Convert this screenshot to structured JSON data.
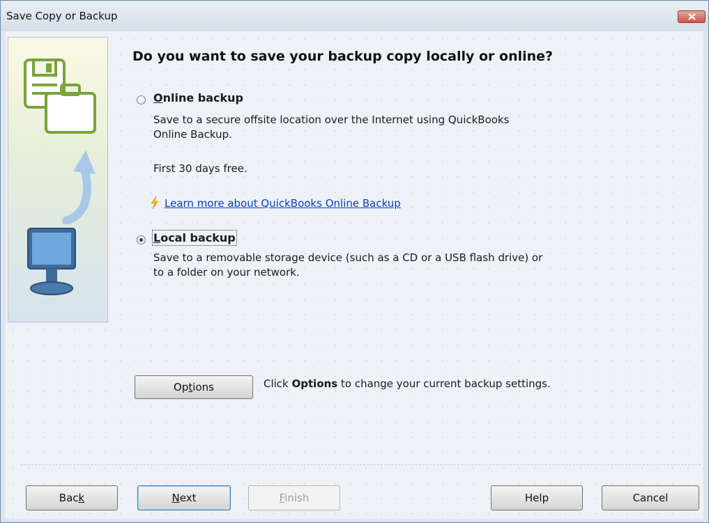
{
  "window": {
    "title": "Save Copy or Backup"
  },
  "heading": "Do you want to save your backup copy locally or online?",
  "online": {
    "label_u": "O",
    "label_rest": "nline backup",
    "desc_line1": "Save to a secure offsite location over the Internet using QuickBooks",
    "desc_line2": "Online Backup.",
    "free": "First 30 days free.",
    "link": "Learn more about QuickBooks Online Backup",
    "checked": false
  },
  "local": {
    "label_u": "L",
    "label_rest": "ocal backup",
    "desc_line1": "Save to a removable storage device (such as a CD or a USB flash drive) or",
    "desc_line2": "to a folder on your network.",
    "checked": true
  },
  "options": {
    "button_pre": "Op",
    "button_u": "t",
    "button_post": "ions",
    "hint_pre": "Click ",
    "hint_bold": "Options",
    "hint_post": " to change your current backup settings."
  },
  "buttons": {
    "back_pre": "Bac",
    "back_u": "k",
    "next_u": "N",
    "next_post": "ext",
    "finish_u": "F",
    "finish_post": "inish",
    "help": "Help",
    "cancel": "Cancel"
  },
  "icons": {
    "close": "close-icon",
    "save_briefcase": "save-briefcase-icon",
    "arrow": "curved-arrow-icon",
    "monitor": "monitor-icon",
    "lightning": "lightning-icon"
  }
}
